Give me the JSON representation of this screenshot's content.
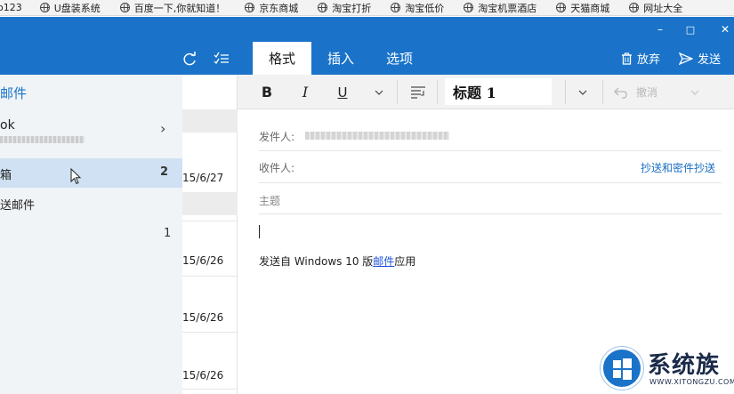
{
  "bookmarks": [
    {
      "label": "o123",
      "icon": "globe-icon"
    },
    {
      "label": "U盘装系统",
      "icon": "globe-icon"
    },
    {
      "label": "百度一下,你就知道！",
      "icon": "globe-icon"
    },
    {
      "label": "京东商城",
      "icon": "globe-icon"
    },
    {
      "label": "淘宝打折",
      "icon": "globe-icon"
    },
    {
      "label": "淘宝低价",
      "icon": "globe-icon"
    },
    {
      "label": "淘宝机票酒店",
      "icon": "globe-icon"
    },
    {
      "label": "天猫商城",
      "icon": "globe-icon"
    },
    {
      "label": "网址大全",
      "icon": "globe-icon"
    }
  ],
  "window": {
    "minimize": "–",
    "maximize": "□",
    "close": "✕"
  },
  "toolbar": {
    "tabs": [
      "格式",
      "插入",
      "选项"
    ],
    "active_tab": "格式",
    "discard_label": "放弃",
    "send_label": "发送"
  },
  "nav": {
    "title": "邮件",
    "account_name": "ok",
    "folders": [
      {
        "label": "箱",
        "count": "2"
      },
      {
        "label": "送邮件",
        "count": ""
      },
      {
        "label": "",
        "count": "1"
      }
    ]
  },
  "message_list": {
    "dates": [
      "15/6/27",
      "15/6/26",
      "15/6/26",
      "15/6/26"
    ]
  },
  "ribbon": {
    "bold": "B",
    "italic": "I",
    "underline": "U",
    "style": "标题 1",
    "undo": "撤消"
  },
  "compose": {
    "from_label": "发件人:",
    "to_label": "收件人:",
    "subject_placeholder": "主题",
    "cc_bcc_label": "抄送和密件抄送",
    "signature_prefix": "发送自  Windows 10  版",
    "signature_link": "邮件",
    "signature_suffix": "应用"
  },
  "watermark": {
    "brand": "系统族",
    "url": "WWW.XITONGZU.COM"
  },
  "colors": {
    "accent": "#1a73c9",
    "link": "#1a6ec2",
    "selection": "#cfe1f2"
  }
}
